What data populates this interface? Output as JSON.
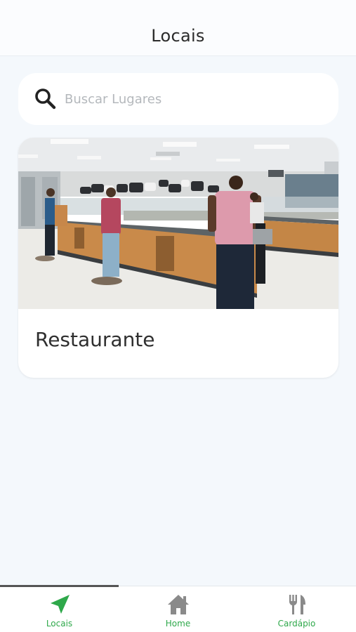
{
  "header": {
    "title": "Locais"
  },
  "search": {
    "placeholder": "Buscar Lugares",
    "icon": "search-icon"
  },
  "places": [
    {
      "name": "Restaurante",
      "image": "restaurant-buffet-photo"
    }
  ],
  "tabbar": {
    "active_index": 0,
    "tabs": [
      {
        "label": "Locais",
        "icon": "navigation-arrow-icon"
      },
      {
        "label": "Home",
        "icon": "home-icon"
      },
      {
        "label": "Cardápio",
        "icon": "fork-knife-icon"
      }
    ]
  },
  "colors": {
    "accent": "#2ea84a",
    "background": "#f4f8fc",
    "card": "#ffffff",
    "inactive_icon": "#8a8a8a"
  }
}
